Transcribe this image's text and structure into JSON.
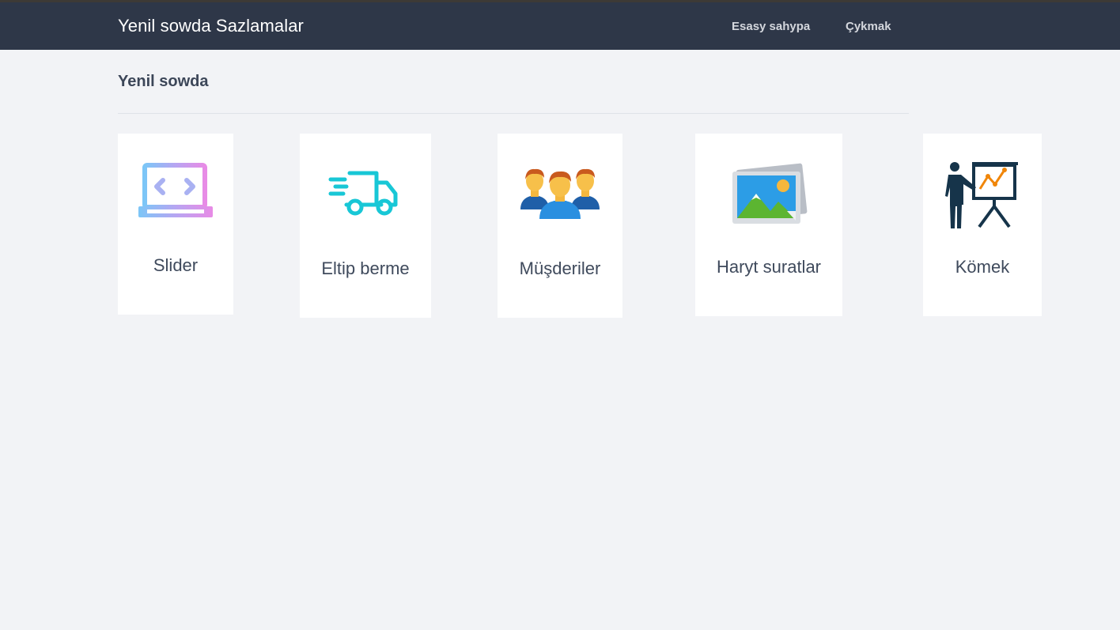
{
  "header": {
    "title": "Yenil sowda Sazlamalar",
    "nav": {
      "home": "Esasy sahypa",
      "logout": "Çykmak"
    }
  },
  "section": {
    "title": "Yenil sowda"
  },
  "cards": [
    {
      "label": "Slider",
      "icon": "laptop-code-icon"
    },
    {
      "label": "Eltip berme",
      "icon": "delivery-truck-icon"
    },
    {
      "label": "Müşderiler",
      "icon": "customers-group-icon"
    },
    {
      "label": "Haryt suratlar",
      "icon": "product-photos-icon"
    },
    {
      "label": "Kömek",
      "icon": "presentation-help-icon"
    }
  ],
  "colors": {
    "header_bg": "#2e3748",
    "page_bg": "#f2f3f6",
    "card_bg": "#ffffff",
    "text": "#3f4a5c"
  }
}
